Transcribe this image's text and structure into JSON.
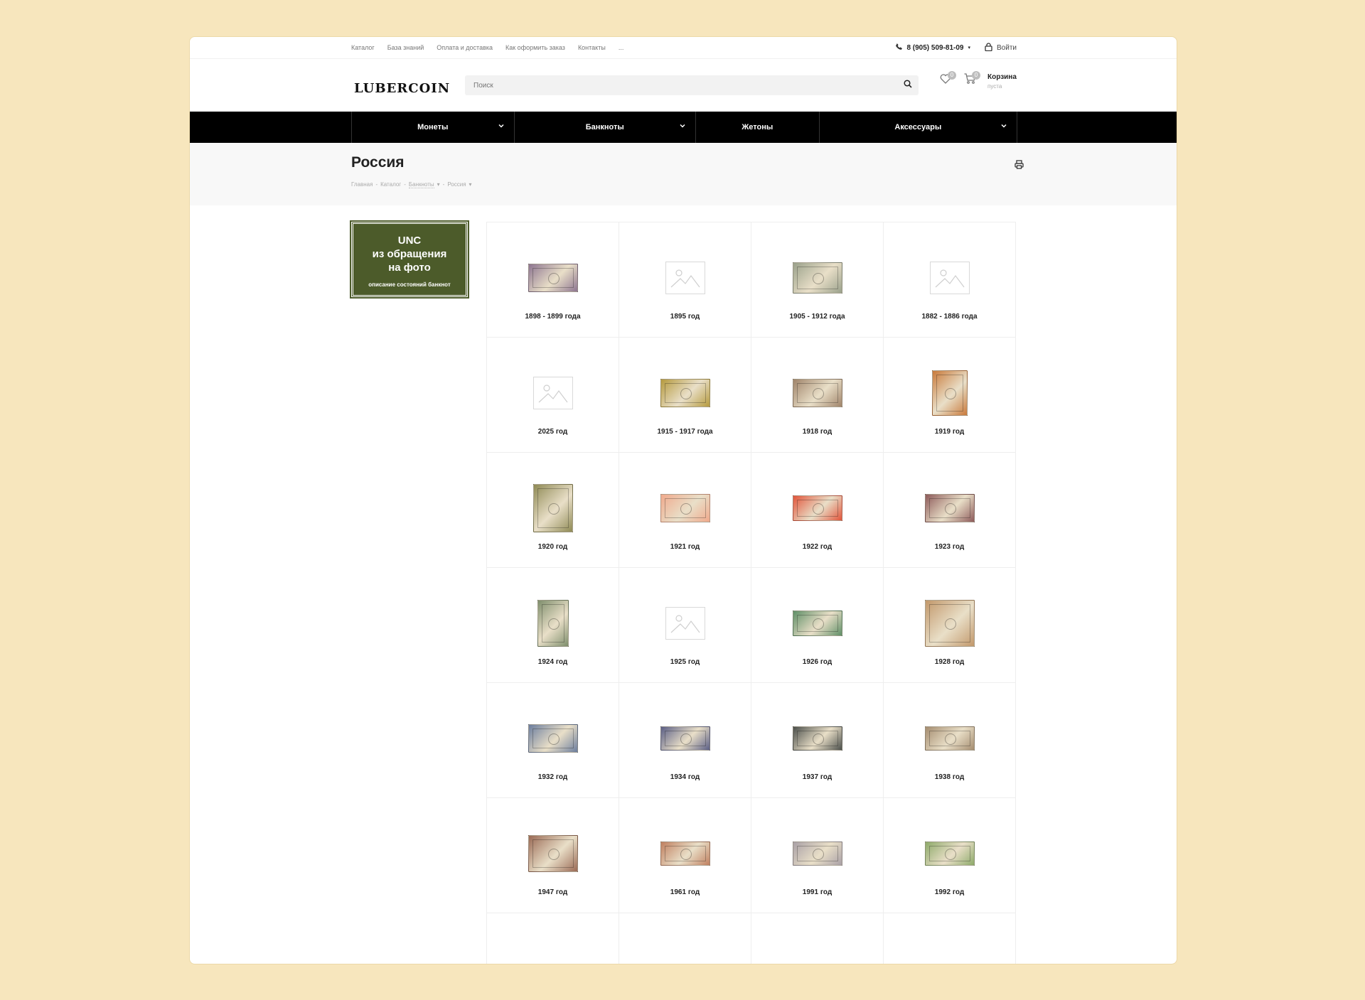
{
  "topnav": {
    "links": [
      "Каталог",
      "База знаний",
      "Оплата и доставка",
      "Как оформить заказ",
      "Контакты",
      "..."
    ],
    "phone": "8 (905) 509-81-09",
    "login": "Войти"
  },
  "header": {
    "logo": "LUBERCOIN",
    "search_placeholder": "Поиск",
    "favorites_count": "0",
    "cart_count": "0",
    "cart_title": "Корзина",
    "cart_status": "пуста"
  },
  "menu": {
    "items": [
      "Монеты",
      "Банкноты",
      "Жетоны",
      "Аксессуары"
    ]
  },
  "page": {
    "title": "Россия",
    "breadcrumbs": [
      "Главная",
      "Каталог",
      "Банкноты",
      "Россия"
    ]
  },
  "banner": {
    "line1": "UNC",
    "line2": "из обращения",
    "line3": "на фото",
    "line4": "описание состояний банкнот"
  },
  "grid": {
    "items": [
      {
        "label": "1898 - 1899 года",
        "color": "#8d7590"
      },
      {
        "label": "1895 год",
        "color": ""
      },
      {
        "label": "1905 - 1912 года",
        "color": "#9aa18b"
      },
      {
        "label": "1882 - 1886 года",
        "color": ""
      },
      {
        "label": "2025 год",
        "color": ""
      },
      {
        "label": "1915 - 1917 года",
        "color": "#b59a3e"
      },
      {
        "label": "1918 год",
        "color": "#a0846a"
      },
      {
        "label": "1919 год",
        "color": "#c97a3b"
      },
      {
        "label": "1920 год",
        "color": "#8f8a55"
      },
      {
        "label": "1921 год",
        "color": "#f0a98c"
      },
      {
        "label": "1922 год",
        "color": "#e2553b"
      },
      {
        "label": "1923 год",
        "color": "#8d5a5a"
      },
      {
        "label": "1924 год",
        "color": "#7f8f6d"
      },
      {
        "label": "1925 год",
        "color": ""
      },
      {
        "label": "1926 год",
        "color": "#5f8f67"
      },
      {
        "label": "1928 год",
        "color": "#c2986b"
      },
      {
        "label": "1932 год",
        "color": "#6c7e9e"
      },
      {
        "label": "1934 год",
        "color": "#5b5f86"
      },
      {
        "label": "1937 год",
        "color": "#4b4f4b"
      },
      {
        "label": "1938 год",
        "color": "#a58d70"
      },
      {
        "label": "1947 год",
        "color": "#9a6a55"
      },
      {
        "label": "1961 год",
        "color": "#c08060"
      },
      {
        "label": "1991 год",
        "color": "#a9a0a6"
      },
      {
        "label": "1992 год",
        "color": "#8eaa6a"
      },
      {
        "label": "",
        "color": "#7f8fc0"
      },
      {
        "label": "",
        "color": "#a07a70"
      },
      {
        "label": "",
        "color": "#7a8c8a"
      },
      {
        "label": "",
        "color": "#5c7fb5"
      }
    ]
  }
}
